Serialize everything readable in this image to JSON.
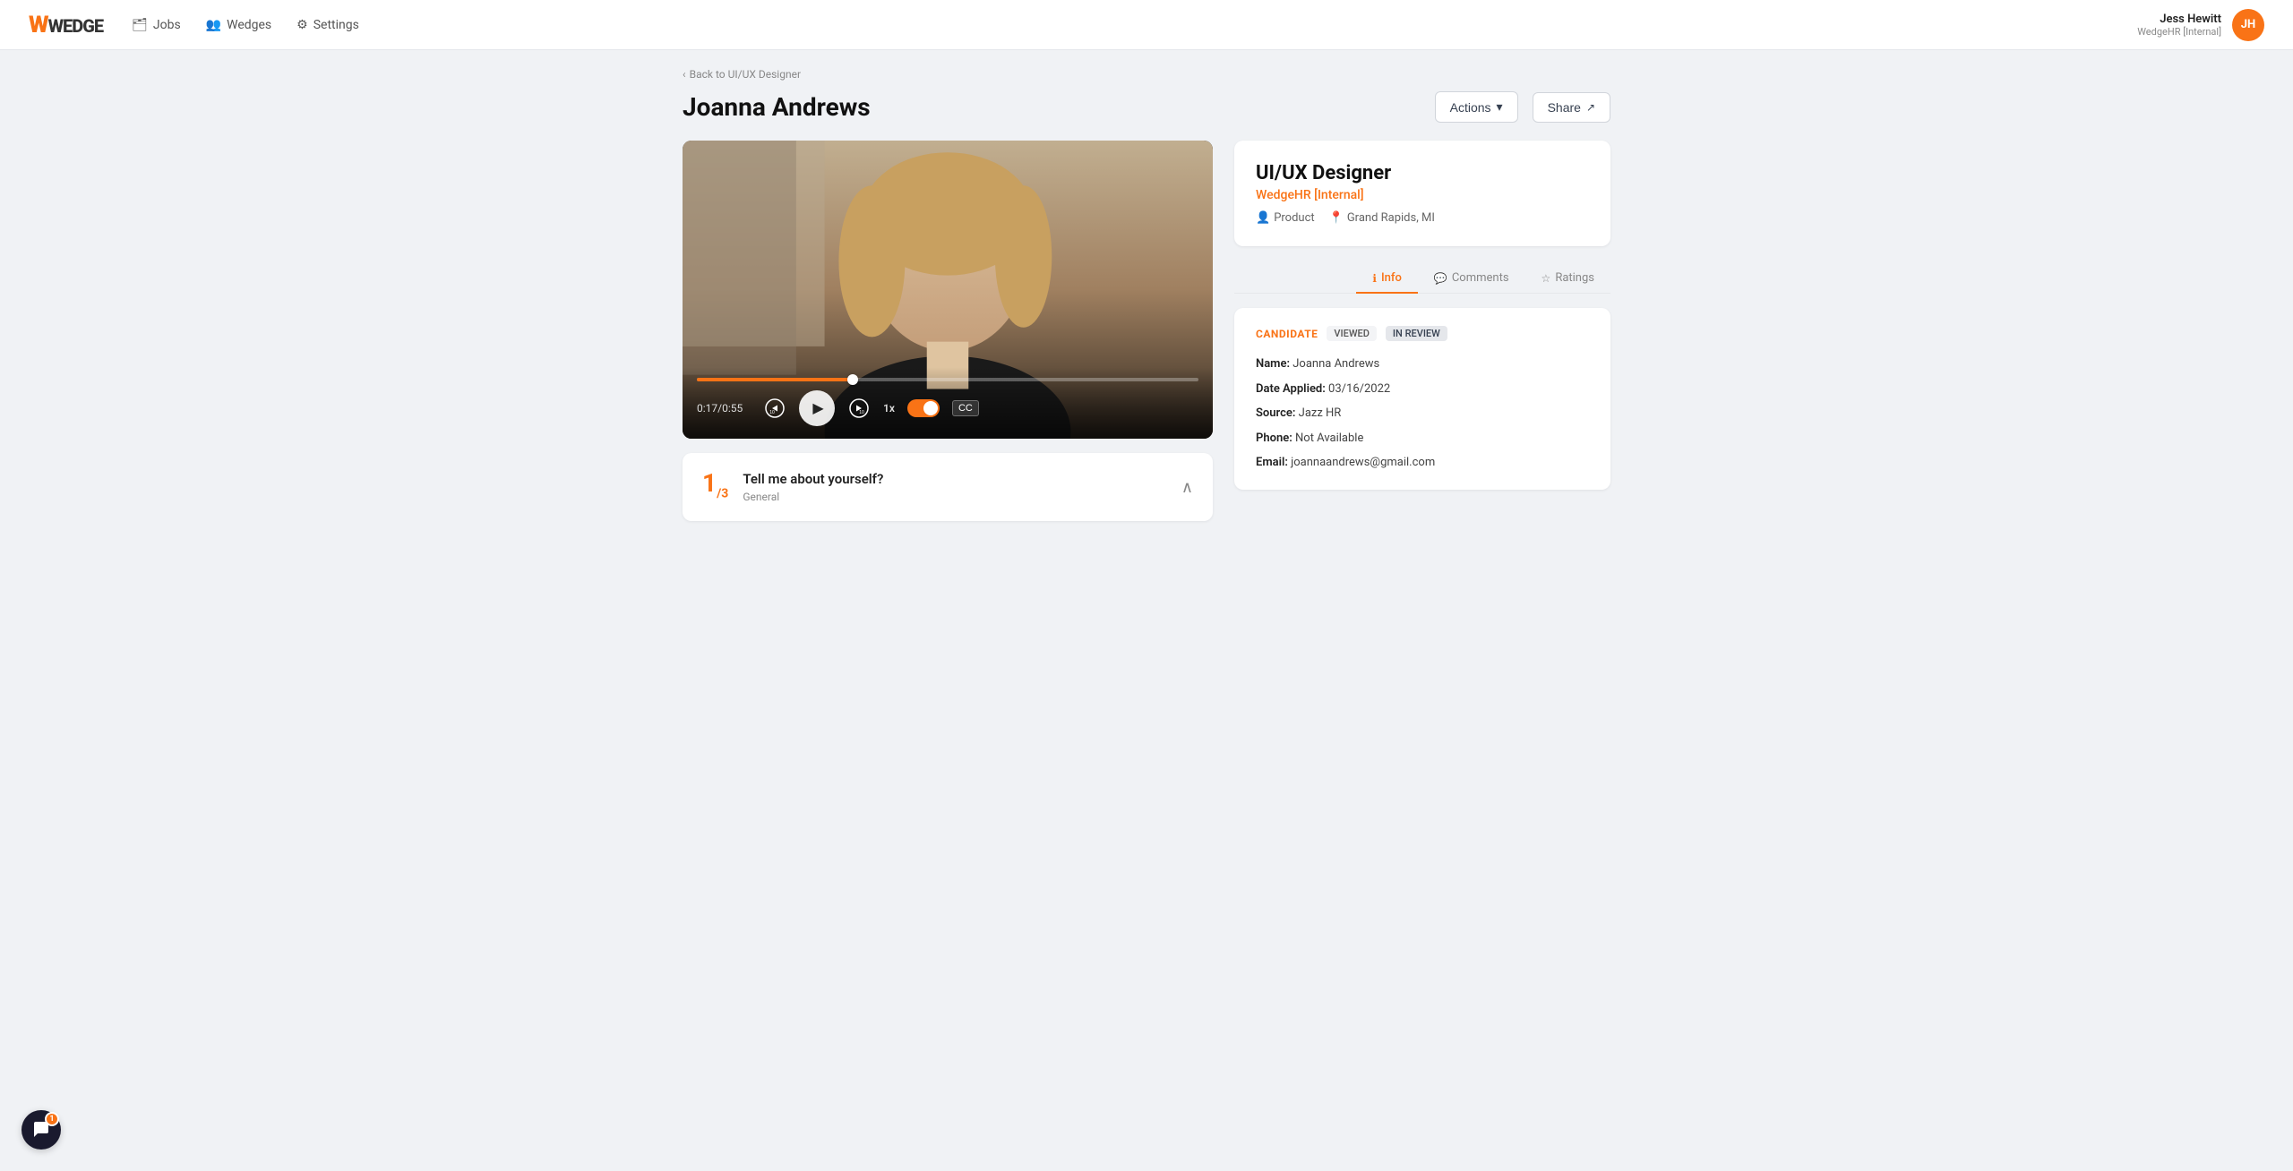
{
  "navbar": {
    "logo": "WEDGE",
    "nav_items": [
      {
        "id": "jobs",
        "label": "Jobs",
        "icon": "briefcase"
      },
      {
        "id": "wedges",
        "label": "Wedges",
        "icon": "users"
      },
      {
        "id": "settings",
        "label": "Settings",
        "icon": "gear"
      }
    ],
    "user": {
      "name": "Jess Hewitt",
      "org": "WedgeHR [Internal]",
      "initials": "JH"
    }
  },
  "breadcrumb": {
    "label": "< Back to UI/UX Designer",
    "link": "#"
  },
  "page": {
    "title": "Joanna Andrews",
    "actions_label": "Actions",
    "share_label": "Share"
  },
  "video": {
    "time_current": "0:17",
    "time_total": "0:55",
    "speed": "1x",
    "progress_pct": 31
  },
  "question": {
    "number": "1",
    "total": "3",
    "text": "Tell me about yourself?",
    "category": "General"
  },
  "job": {
    "title": "UI/UX Designer",
    "org": "WedgeHR [Internal]",
    "department": "Product",
    "location": "Grand Rapids, MI"
  },
  "tabs": [
    {
      "id": "info",
      "label": "Info",
      "icon": "info",
      "active": true
    },
    {
      "id": "comments",
      "label": "Comments",
      "icon": "comment",
      "active": false
    },
    {
      "id": "ratings",
      "label": "Ratings",
      "icon": "star",
      "active": false
    }
  ],
  "candidate": {
    "label": "CANDIDATE",
    "status_viewed": "VIEWED",
    "status_review": "IN REVIEW",
    "name_label": "Name:",
    "name_value": "Joanna Andrews",
    "date_label": "Date Applied:",
    "date_value": "03/16/2022",
    "source_label": "Source:",
    "source_value": "Jazz HR",
    "phone_label": "Phone:",
    "phone_value": "Not Available",
    "email_label": "Email:",
    "email_value": "joannaandrews@gmail.com"
  },
  "chat": {
    "notification_count": "1"
  }
}
